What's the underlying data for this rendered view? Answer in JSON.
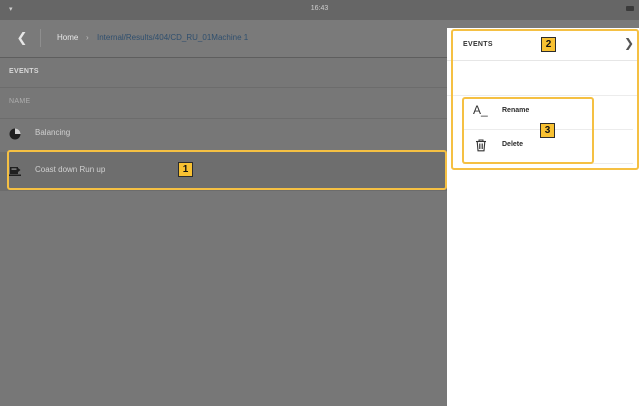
{
  "status_bar": {
    "signal": "▾",
    "time": "16:43"
  },
  "nav": {
    "back_icon": "chevron-left-icon",
    "home_label": "Home",
    "separator": "›",
    "path": "Internal/Results/404/CD_RU_01Machine 1"
  },
  "list": {
    "section_title": "EVENTS",
    "column_header": "NAME",
    "rows": [
      {
        "label": "Balancing",
        "icon": "balancing-icon"
      },
      {
        "label": "Coast down Run up",
        "icon": "coast-down-run-up-icon"
      }
    ]
  },
  "panel": {
    "title": "EVENTS",
    "chevron_icon": "chevron-right-icon",
    "menu": [
      {
        "label": "Rename",
        "icon": "rename-icon",
        "icon_text": "A_"
      },
      {
        "label": "Delete",
        "icon": "trash-icon"
      }
    ]
  },
  "callouts": {
    "marker_1": "1",
    "marker_2": "2",
    "marker_3": "3",
    "color": "#f5c043"
  }
}
